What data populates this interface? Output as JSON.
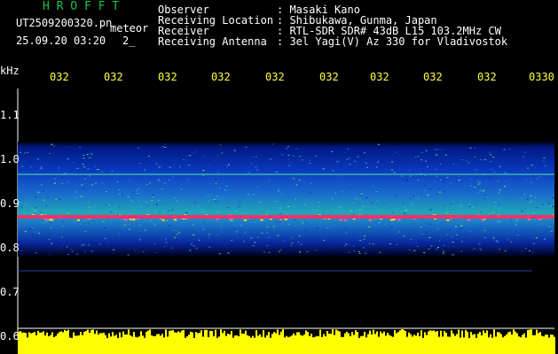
{
  "header": {
    "app_name": "H R O F F T",
    "filename": "UT2509200320.pn",
    "mode_label": "meteor",
    "datetime": "25.09.20 03:20",
    "count_text": "2_"
  },
  "info": {
    "observer_label": "Observer",
    "observer_value": ": Masaki Kano",
    "location_label": "Receiving Location",
    "location_value": ": Shibukawa, Gunma, Japan",
    "receiver_label": "Receiver",
    "receiver_value": ": RTL-SDR SDR# 43dB L15 103.2MHz CW",
    "antenna_label": "Receiving Antenna",
    "antenna_value": ": 3el Yagi(V) Az 330 for Vladivostok"
  },
  "axis": {
    "unit_label": "kHz",
    "y_ticks": [
      "1.1",
      "1.0",
      "0.9",
      "0.8",
      "0.7",
      "0.6"
    ],
    "x_ticks": [
      "032",
      "032",
      "032",
      "032",
      "032",
      "032",
      "032",
      "032",
      "032",
      "0330"
    ]
  },
  "colors": {
    "background": "#000000",
    "title": "#19c64a",
    "labels": "#ffffff",
    "time_ticks": "#ffff40",
    "noise_floor": "#ffff00",
    "echo_line": "#ff2a6a"
  }
}
